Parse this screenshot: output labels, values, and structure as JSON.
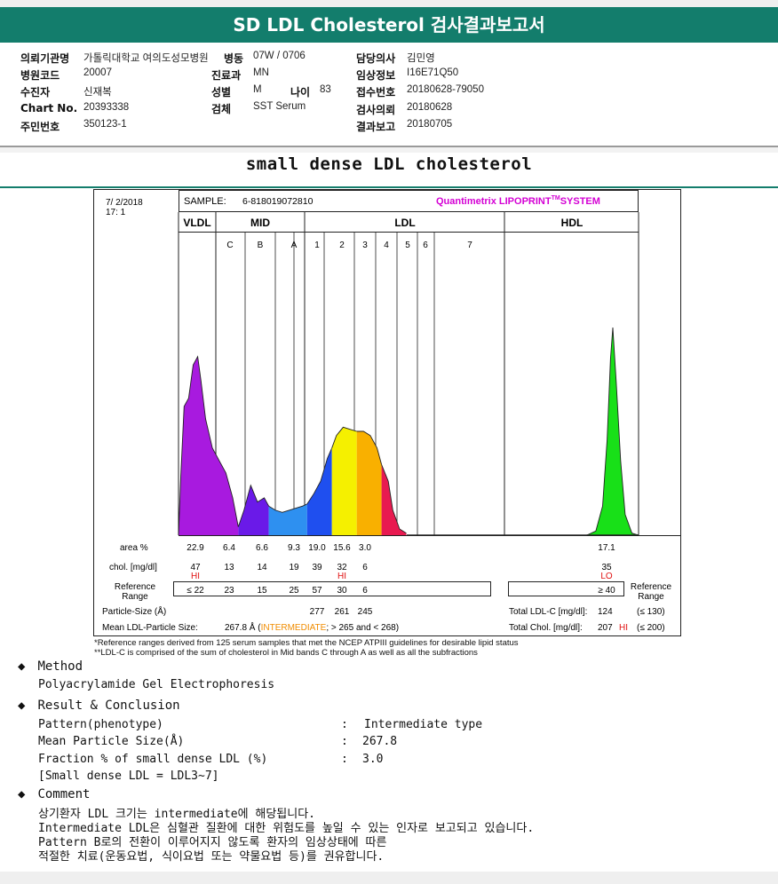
{
  "report": {
    "title": "SD LDL Cholesterol 검사결과보고서",
    "subtitle": "small dense LDL cholesterol"
  },
  "patient": {
    "institution_label": "의뢰기관명",
    "institution": "가톨릭대학교 여의도성모병원",
    "ward_label": "병동",
    "ward": "07W / 0706",
    "doctor_label": "담당의사",
    "doctor": "김민영",
    "hospital_code_label": "병원코드",
    "hospital_code": "20007",
    "dept_label": "진료과",
    "dept": "MN",
    "clinical_info_label": "임상정보",
    "clinical_info": "I16E71Q50",
    "examinee_label": "수진자",
    "examinee": "신재복",
    "sex_label": "성별",
    "sex": "M",
    "age_label": "나이",
    "age": "83",
    "receipt_no_label": "접수번호",
    "receipt_no": "20180628-79050",
    "chart_no_label": "Chart No.",
    "chart_no": "20393338",
    "specimen_label": "검체",
    "specimen": "SST Serum",
    "request_date_label": "검사의뢰",
    "request_date": "20180628",
    "resident_no_label": "주민번호",
    "resident_no": "350123-1",
    "report_date_label": "결과보고",
    "report_date": "20180705"
  },
  "chart_data": {
    "type": "area",
    "date": "7/ 2/2018",
    "time": "17: 1",
    "sample_label": "SAMPLE:",
    "sample": "6-818019072810",
    "system_name": "Quantimetrix LIPOPRINT",
    "system_tm": "TM",
    "system_suffix": "SYSTEM",
    "group_labels": [
      "VLDL",
      "MID",
      "LDL",
      "HDL"
    ],
    "bands": [
      "C",
      "B",
      "A",
      "1",
      "2",
      "3",
      "4",
      "5",
      "6",
      "7"
    ],
    "profile": [
      {
        "band": "VLDL",
        "color": "#a81adf",
        "points": [
          [
            0,
            0
          ],
          [
            0.02,
            0.28
          ],
          [
            0.05,
            0.62
          ],
          [
            0.09,
            0.66
          ],
          [
            0.13,
            0.82
          ],
          [
            0.17,
            0.86
          ],
          [
            0.2,
            0.74
          ],
          [
            0.24,
            0.56
          ],
          [
            0.3,
            0.42
          ],
          [
            0.36,
            0.36
          ],
          [
            0.42,
            0.3
          ],
          [
            0.48,
            0.18
          ],
          [
            0.53,
            0.04
          ]
        ]
      },
      {
        "band": "C",
        "color": "#6a1ae8",
        "points": [
          [
            0.53,
            0.04
          ],
          [
            0.58,
            0.12
          ],
          [
            0.64,
            0.24
          ],
          [
            0.7,
            0.16
          ],
          [
            0.76,
            0.18
          ],
          [
            0.8,
            0.14
          ]
        ]
      },
      {
        "band": "B",
        "color": "#2e90f0",
        "points": [
          [
            0.8,
            0.14
          ],
          [
            0.86,
            0.12
          ],
          [
            0.92,
            0.11
          ],
          [
            0.98,
            0.12
          ],
          [
            1.04,
            0.13
          ],
          [
            1.1,
            0.14
          ],
          [
            1.14,
            0.15
          ]
        ]
      },
      {
        "band": "A",
        "color": "#1f4fef",
        "points": [
          [
            1.14,
            0.15
          ],
          [
            1.2,
            0.2
          ],
          [
            1.26,
            0.26
          ],
          [
            1.32,
            0.37
          ],
          [
            1.36,
            0.42
          ]
        ]
      },
      {
        "band": "1",
        "color": "#f5f000",
        "points": [
          [
            1.36,
            0.42
          ],
          [
            1.4,
            0.48
          ],
          [
            1.46,
            0.52
          ],
          [
            1.52,
            0.51
          ],
          [
            1.58,
            0.5
          ]
        ]
      },
      {
        "band": "2",
        "color": "#f9b000",
        "points": [
          [
            1.58,
            0.5
          ],
          [
            1.64,
            0.5
          ],
          [
            1.7,
            0.48
          ],
          [
            1.76,
            0.42
          ],
          [
            1.8,
            0.34
          ]
        ]
      },
      {
        "band": "3",
        "color": "#e81a50",
        "points": [
          [
            1.8,
            0.34
          ],
          [
            1.86,
            0.26
          ],
          [
            1.9,
            0.12
          ],
          [
            1.96,
            0.03
          ],
          [
            2.02,
            0.01
          ]
        ]
      },
      {
        "band": "HDL",
        "color": "#18e018",
        "points": [
          [
            3.62,
            0
          ],
          [
            3.7,
            0.02
          ],
          [
            3.76,
            0.14
          ],
          [
            3.8,
            0.46
          ],
          [
            3.83,
            0.85
          ],
          [
            3.85,
            1.0
          ],
          [
            3.88,
            0.74
          ],
          [
            3.92,
            0.36
          ],
          [
            3.96,
            0.1
          ],
          [
            4.02,
            0.01
          ],
          [
            4.08,
            0
          ]
        ]
      }
    ],
    "area_label": "area %",
    "area_values": [
      "22.9",
      "6.4",
      "6.6",
      "9.3",
      "19.0",
      "15.6",
      "3.0",
      "17.1"
    ],
    "chol_label": "chol. [mg/dl]",
    "chol_values": [
      "47",
      "13",
      "14",
      "19",
      "39",
      "32",
      "6",
      "35"
    ],
    "flags": {
      "vldl": "HI",
      "ldl2": "HI",
      "hdl": "LO"
    },
    "ref_label": "Reference Range",
    "ref_values": [
      "≤ 22",
      "23",
      "15",
      "25",
      "57",
      "30",
      "6",
      "≥ 40"
    ],
    "particle_size_label": "Particle-Size (Å)",
    "particle_sizes": [
      "277",
      "261",
      "245"
    ],
    "mean_size_label": "Mean LDL-Particle Size:",
    "mean_size_value": "267.8 Å",
    "mean_size_type": "INTERMEDIATE",
    "mean_size_range": "> 265 and < 268",
    "total_ldl_label": "Total LDL-C [mg/dl]:",
    "total_ldl_value": "124",
    "total_ldl_ref": "(≤ 130)",
    "total_chol_label": "Total Chol. [mg/dl]:",
    "total_chol_value": "207",
    "total_chol_flag": "HI",
    "total_chol_ref": "(≤ 200)",
    "footnote1": "*Reference ranges derived from 125 serum samples that met the NCEP ATPIII guidelines for desirable lipid status",
    "footnote2": "**LDL-C is comprised of the sum of cholesterol in Mid bands C through A as well as all the subfractions"
  },
  "method": {
    "header": "Method",
    "text": "Polyacrylamide Gel Electrophoresis"
  },
  "result": {
    "header": "Result & Conclusion",
    "rows": [
      {
        "label": "Pattern(phenotype)",
        "value": "Intermediate type"
      },
      {
        "label": "Mean Particle Size(Å)",
        "value": "267.8"
      },
      {
        "label": "Fraction % of small dense LDL (%)",
        "value": "3.0"
      }
    ],
    "note": "[Small dense LDL = LDL3~7]"
  },
  "comment": {
    "header": "Comment",
    "lines": [
      "상기환자 LDL 크기는 intermediate에 해당됩니다.",
      "Intermediate LDL은 심혈관 질환에 대한 위험도를 높일 수 있는 인자로 보고되고 있습니다.",
      "Pattern B로의 전환이 이루어지지 않도록 환자의 임상상태에 따른",
      "적절한 치료(운동요법, 식이요법 또는 약물요법 등)를 권유합니다."
    ]
  },
  "colors": {
    "title_bar": "#137d6c",
    "system_magenta": "#d400d4",
    "flag_red": "#e01010",
    "intermediate_orange": "#f08c00"
  }
}
